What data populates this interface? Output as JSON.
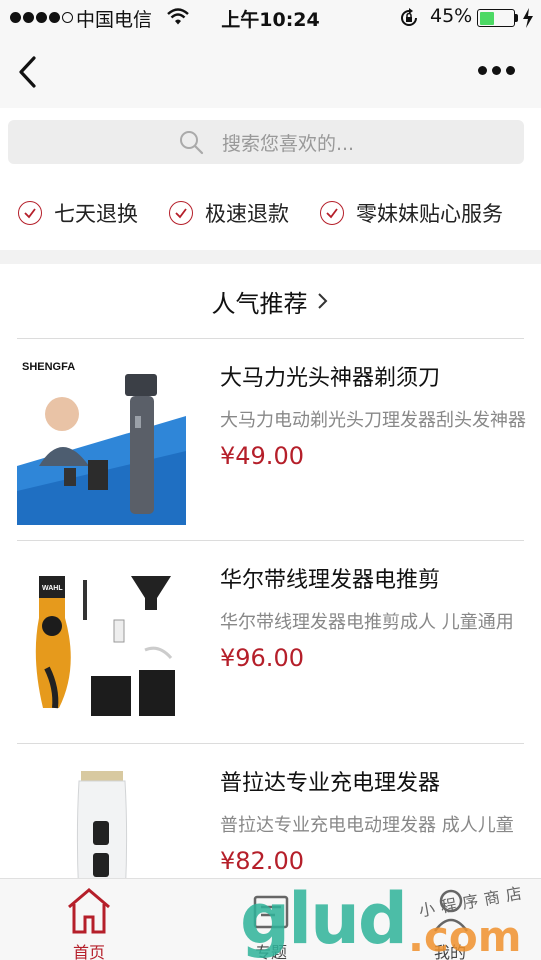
{
  "status_bar": {
    "carrier": "中国电信",
    "time": "上午10:24",
    "battery": "45%",
    "battery_level": 0.45
  },
  "nav": {
    "back_icon": "chevron-left-icon",
    "more_icon": "more-dots-icon"
  },
  "search": {
    "placeholder": "搜索您喜欢的..."
  },
  "guarantees": [
    {
      "label": "七天退换"
    },
    {
      "label": "极速退款"
    },
    {
      "label": "零妹妹贴心服务"
    }
  ],
  "section": {
    "title": "人气推荐"
  },
  "products": [
    {
      "title": "大马力光头神器剃须刀",
      "desc": "大马力电动剃光头刀理发器刮头发神器",
      "price": "¥49.00",
      "brand": "SHENGFA"
    },
    {
      "title": "华尔带线理发器电推剪",
      "desc": "华尔带线理发器电推剪成人 儿童通用",
      "price": "¥96.00",
      "brand": "WAHL"
    },
    {
      "title": "普拉达专业充电理发器",
      "desc": "普拉达专业充电电动理发器 成人儿童",
      "price": "¥82.00"
    }
  ],
  "tabs": [
    {
      "label": "首页",
      "active": true
    },
    {
      "label": "专题",
      "active": false
    },
    {
      "label": "我的",
      "active": false
    }
  ],
  "watermark": {
    "brand": "glud",
    "domain": ".com",
    "caption": "小程序商店"
  },
  "colors": {
    "accent": "#b51f2a",
    "bar_bg": "#f7f7f7",
    "search_bg": "#ededed"
  }
}
